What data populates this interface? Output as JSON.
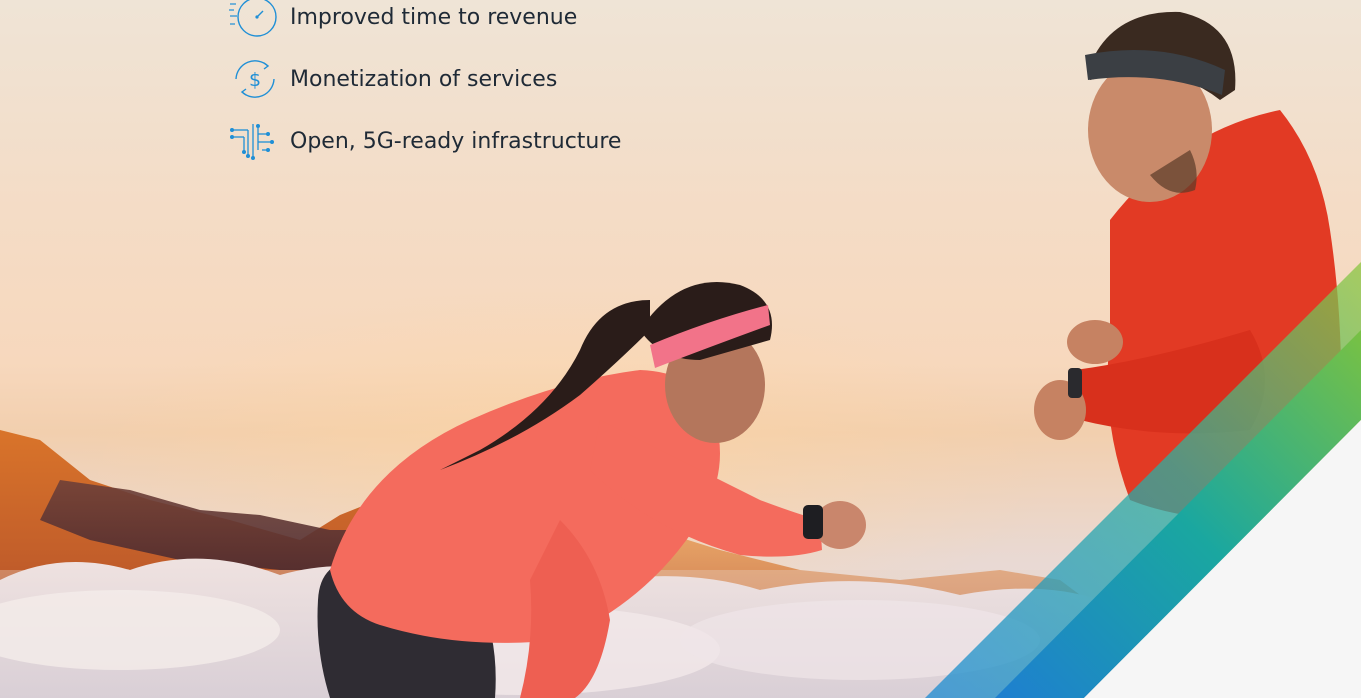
{
  "benefits": [
    {
      "icon": "stopwatch-icon",
      "text": "Improved time to revenue"
    },
    {
      "icon": "dollar-cycle-icon",
      "text": "Monetization of services"
    },
    {
      "icon": "circuit-network-icon",
      "text": "Open, 5G-ready infrastructure"
    }
  ],
  "colors": {
    "text": "#1f2a36",
    "icon_blue": "#1f8fd6",
    "accent_green": "#78c143",
    "accent_teal": "#1aa7a0",
    "accent_blue": "#1e88d5",
    "corner_panel": "#f6f6f6"
  }
}
